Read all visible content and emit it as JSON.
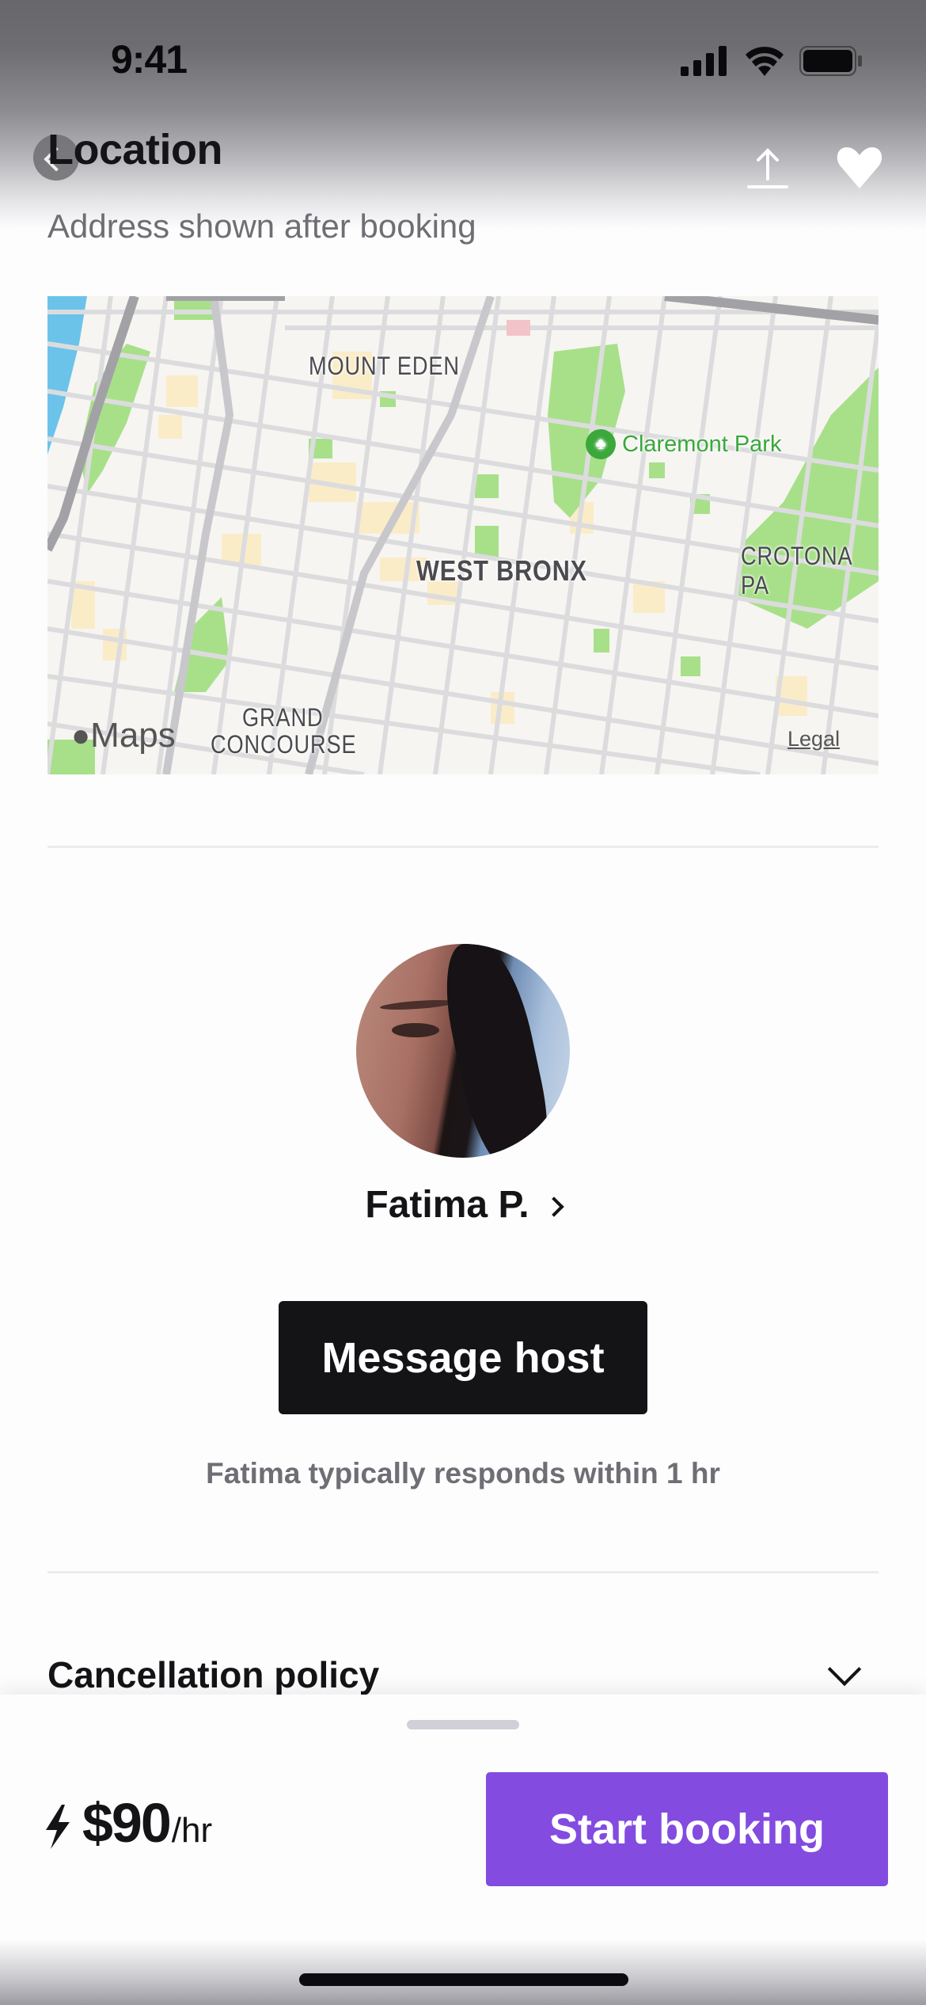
{
  "status_bar": {
    "time": "9:41",
    "icons": [
      "cellular-signal-icon",
      "wifi-icon",
      "battery-icon"
    ]
  },
  "header": {
    "title": "Location",
    "back_icon": "chevron-left-icon",
    "share_icon": "share-upload-icon",
    "favorite_icon": "heart-icon"
  },
  "location": {
    "subtitle": "Address shown after booking",
    "map": {
      "labels": [
        "MOUNT EDEN",
        "WEST BRONX",
        "CROTONA PA",
        "GRAND",
        "CONCOURSE"
      ],
      "poi": "Claremont Park",
      "attribution": "Maps",
      "legal": "Legal",
      "colors": {
        "park": "#a8e08a",
        "water": "#6cc3ea",
        "road": "#dcdcde",
        "highway": "#a2a2a6",
        "residential": "#fbecc8",
        "poi_text": "#3aa83a"
      }
    }
  },
  "host": {
    "name": "Fatima P.",
    "message_button": "Message host",
    "response_time": "Fatima typically responds within 1 hr"
  },
  "cancellation": {
    "title": "Cancellation policy",
    "expand_icon": "chevron-down-icon"
  },
  "booking_bar": {
    "instant_icon": "lightning-bolt-icon",
    "price": "$90",
    "unit": "/hr",
    "cta": "Start booking",
    "cta_color": "#834be0"
  }
}
